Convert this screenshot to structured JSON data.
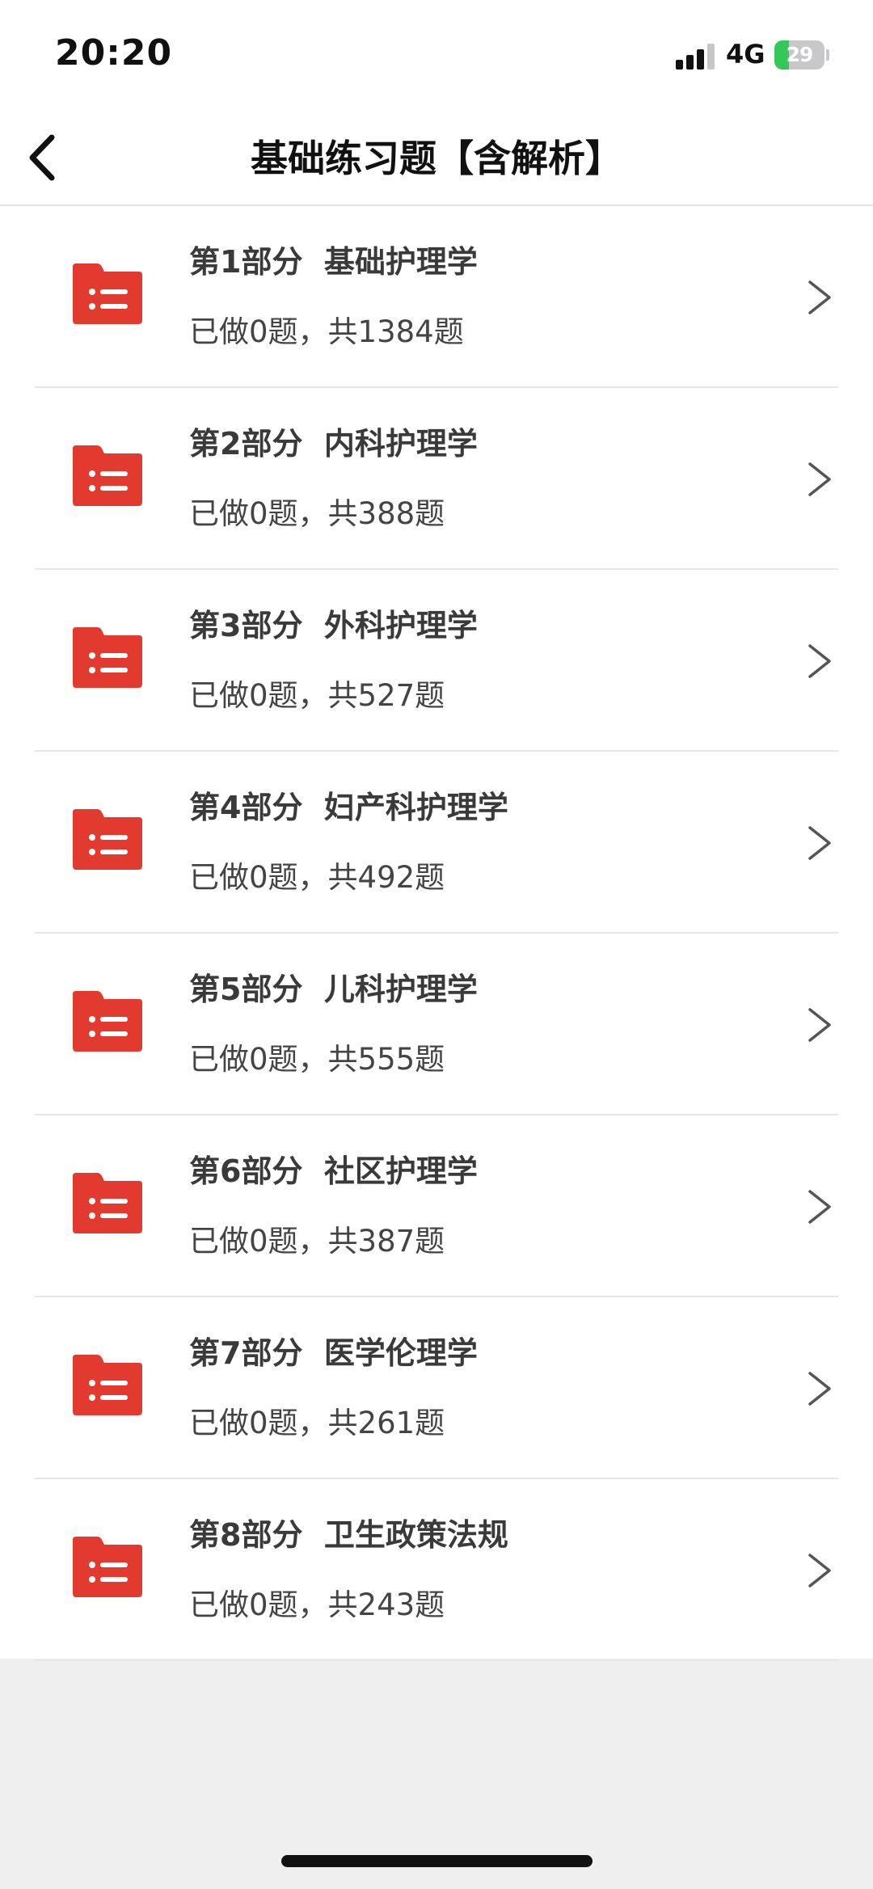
{
  "status_bar": {
    "time": "20:20",
    "network": "4G",
    "battery_level": "29",
    "battery_fraction": 0.29,
    "signal_bars_active": 3,
    "signal_bars_total": 4
  },
  "nav": {
    "back_icon": "chevron-left-icon",
    "title": "基础练习题【含解析】"
  },
  "colors": {
    "accent": "#e23a2e",
    "battery": "#35c759"
  },
  "sections": [
    {
      "title": "第1部分  基础护理学",
      "progress": "已做0题，共1384题"
    },
    {
      "title": "第2部分  内科护理学",
      "progress": "已做0题，共388题"
    },
    {
      "title": "第3部分  外科护理学",
      "progress": "已做0题，共527题"
    },
    {
      "title": "第4部分  妇产科护理学",
      "progress": "已做0题，共492题"
    },
    {
      "title": "第5部分  儿科护理学",
      "progress": "已做0题，共555题"
    },
    {
      "title": "第6部分  社区护理学",
      "progress": "已做0题，共387题"
    },
    {
      "title": "第7部分  医学伦理学",
      "progress": "已做0题，共261题"
    },
    {
      "title": "第8部分  卫生政策法规",
      "progress": "已做0题，共243题"
    }
  ]
}
